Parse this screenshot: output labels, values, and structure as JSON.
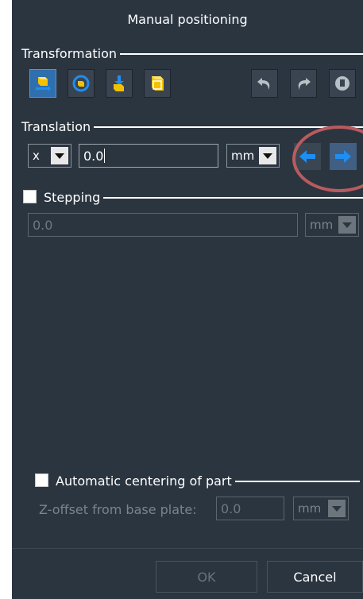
{
  "dialog": {
    "title": "Manual positioning"
  },
  "transformation": {
    "label": "Transformation",
    "tools": [
      {
        "icon": "translate-part-icon",
        "active": true
      },
      {
        "icon": "rotate-part-icon",
        "active": false
      },
      {
        "icon": "place-on-plate-icon",
        "active": false
      },
      {
        "icon": "scale-part-icon",
        "active": false
      }
    ],
    "actions": [
      {
        "icon": "undo-icon"
      },
      {
        "icon": "redo-icon"
      },
      {
        "icon": "reset-icon"
      }
    ]
  },
  "translation": {
    "label": "Translation",
    "axis": "x",
    "value": "0.0",
    "unit": "mm"
  },
  "stepping": {
    "label": "Stepping",
    "checked": false,
    "value": "0.0",
    "unit": "mm"
  },
  "centering": {
    "label": "Automatic centering of part",
    "checked": false,
    "z_offset_label": "Z-offset from base plate:",
    "z_offset_value": "0.0",
    "unit": "mm"
  },
  "buttons": {
    "ok": "OK",
    "cancel": "Cancel"
  },
  "colors": {
    "panel_bg": "#2b3540",
    "accent": "#2f6fae",
    "arrow": "#1f8ef1",
    "highlight": "#b95b5e"
  }
}
